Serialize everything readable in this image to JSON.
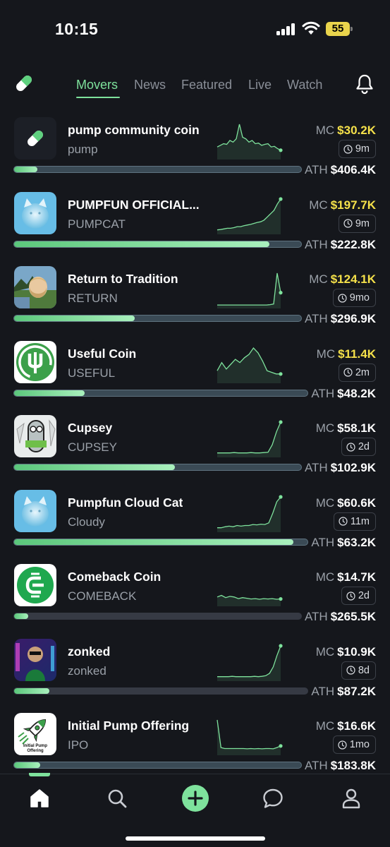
{
  "status_bar": {
    "time": "10:15",
    "battery": "55"
  },
  "nav": {
    "tabs": [
      "Movers",
      "News",
      "Featured",
      "Live",
      "Watchlist"
    ],
    "active_tab": "Movers"
  },
  "labels": {
    "mc": "MC",
    "ath": "ATH"
  },
  "colors": {
    "accent": "#7ee29c",
    "mc_highlight": "#f5e14a",
    "background": "#15171c"
  },
  "coins": [
    {
      "name": "pump community coin",
      "ticker": "pump",
      "mc": "$30.2K",
      "mc_highlight": true,
      "age": "9m",
      "ath": "$406.4K",
      "progress": 0.08,
      "progress_style": "bright",
      "icon": "pill-icon",
      "spark": [
        0.3,
        0.35,
        0.4,
        0.38,
        0.5,
        0.45,
        0.55,
        1.0,
        0.6,
        0.55,
        0.45,
        0.5,
        0.4,
        0.42,
        0.35,
        0.38,
        0.4,
        0.3,
        0.32,
        0.25,
        0.2
      ]
    },
    {
      "name": "PUMPFUN OFFICIAL...",
      "ticker": "PUMPCAT",
      "mc": "$197.7K",
      "mc_highlight": true,
      "age": "9m",
      "ath": "$222.8K",
      "progress": 0.89,
      "progress_style": "bright",
      "icon": "cloud-cat-icon",
      "spark": [
        0.05,
        0.06,
        0.08,
        0.1,
        0.1,
        0.12,
        0.15,
        0.15,
        0.18,
        0.2,
        0.22,
        0.25,
        0.28,
        0.3,
        0.35,
        0.45,
        0.55,
        0.65,
        0.85,
        1.0
      ]
    },
    {
      "name": "Return to Tradition",
      "ticker": "RETURN",
      "mc": "$124.1K",
      "mc_highlight": true,
      "age": "9mo",
      "ath": "$296.9K",
      "progress": 0.42,
      "progress_style": "bright",
      "icon": "bearded-man-icon",
      "spark": [
        0.02,
        0.02,
        0.02,
        0.02,
        0.02,
        0.02,
        0.02,
        0.02,
        0.02,
        0.02,
        0.02,
        0.02,
        0.02,
        0.02,
        0.02,
        0.03,
        0.05,
        1.0,
        0.4
      ]
    },
    {
      "name": "Useful Coin",
      "ticker": "USEFUL",
      "mc": "$11.4K",
      "mc_highlight": true,
      "age": "2m",
      "ath": "$48.2K",
      "progress": 0.24,
      "progress_style": "bright",
      "icon": "useful-logo-icon",
      "spark": [
        0.3,
        0.55,
        0.35,
        0.5,
        0.65,
        0.55,
        0.7,
        0.8,
        1.0,
        0.85,
        0.6,
        0.3,
        0.25,
        0.2,
        0.2
      ]
    },
    {
      "name": "Cupsey",
      "ticker": "CUPSEY",
      "mc": "$58.1K",
      "mc_highlight": false,
      "age": "2d",
      "ath": "$102.9K",
      "progress": 0.56,
      "progress_style": "bright",
      "icon": "cupsey-character-icon",
      "spark": [
        0.05,
        0.05,
        0.05,
        0.05,
        0.06,
        0.05,
        0.05,
        0.05,
        0.06,
        0.05,
        0.05,
        0.06,
        0.07,
        0.3,
        0.7,
        1.0
      ]
    },
    {
      "name": "Pumpfun Cloud Cat",
      "ticker": "Cloudy",
      "mc": "$60.6K",
      "mc_highlight": false,
      "age": "11m",
      "ath": "$63.2K",
      "progress": 0.95,
      "progress_style": "bright",
      "icon": "cloud-cat-icon",
      "spark": [
        0.05,
        0.05,
        0.08,
        0.1,
        0.08,
        0.12,
        0.1,
        0.12,
        0.12,
        0.15,
        0.14,
        0.16,
        0.15,
        0.2,
        0.5,
        0.85,
        1.0
      ]
    },
    {
      "name": "Comeback Coin",
      "ticker": "COMEBACK",
      "mc": "$14.7K",
      "mc_highlight": false,
      "age": "2d",
      "ath": "$265.5K",
      "progress": 0.05,
      "progress_style": "dim",
      "icon": "comeback-logo-icon",
      "spark": [
        0.2,
        0.25,
        0.18,
        0.22,
        0.2,
        0.15,
        0.18,
        0.16,
        0.14,
        0.15,
        0.13,
        0.15,
        0.14,
        0.15,
        0.13,
        0.14
      ]
    },
    {
      "name": "zonked",
      "ticker": "zonked",
      "mc": "$10.9K",
      "mc_highlight": false,
      "age": "8d",
      "ath": "$87.2K",
      "progress": 0.12,
      "progress_style": "dim",
      "icon": "zonked-character-icon",
      "spark": [
        0.05,
        0.05,
        0.05,
        0.05,
        0.06,
        0.05,
        0.05,
        0.05,
        0.05,
        0.05,
        0.06,
        0.05,
        0.06,
        0.08,
        0.15,
        0.35,
        0.7,
        1.0
      ]
    },
    {
      "name": "Initial Pump Offering",
      "ticker": "IPO",
      "mc": "$16.6K",
      "mc_highlight": false,
      "age": "1mo",
      "ath": "$183.8K",
      "progress": 0.09,
      "progress_style": "bright",
      "icon": "rocket-logo-icon",
      "icon_caption": "Initial Pump Offering",
      "spark": [
        1.0,
        0.15,
        0.12,
        0.12,
        0.12,
        0.12,
        0.12,
        0.12,
        0.11,
        0.12,
        0.11,
        0.12,
        0.11,
        0.12,
        0.12,
        0.11,
        0.15,
        0.2
      ]
    }
  ],
  "bottom_nav": {
    "items": [
      {
        "name": "home",
        "active": true
      },
      {
        "name": "search",
        "active": false
      },
      {
        "name": "create",
        "active": false
      },
      {
        "name": "chat",
        "active": false
      },
      {
        "name": "profile",
        "active": false
      }
    ]
  }
}
